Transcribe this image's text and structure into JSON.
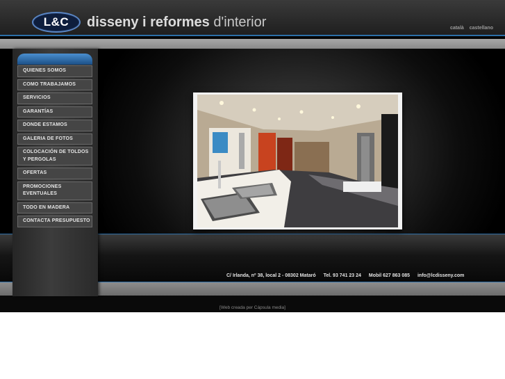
{
  "header": {
    "logo_mark": "L&C",
    "brand_bold": "disseny i reformes",
    "brand_light": "d'interior",
    "languages": [
      "català",
      "castellano"
    ]
  },
  "sidebar": {
    "items": [
      {
        "label": "QUIENES SOMOS"
      },
      {
        "label": "COMO TRABAJAMOS"
      },
      {
        "label": "SERVICIOS"
      },
      {
        "label": "GARANTÍAS"
      },
      {
        "label": "DONDE ESTAMOS"
      },
      {
        "label": "GALERIA DE FOTOS"
      },
      {
        "label": "COLOCACIÓN DE TOLDOS Y PERGOLAS"
      },
      {
        "label": "OFERTAS"
      },
      {
        "label": "PROMOCIONES EVENTUALES"
      },
      {
        "label": "TODO EN MADERA"
      },
      {
        "label": "CONTACTA PRESUPUESTO"
      }
    ]
  },
  "main": {
    "photo_icon": "showroom-kitchen-photo"
  },
  "footer": {
    "address": "C/ Irlanda, nº 38, local 2 - 08302 Mataró",
    "phone": "Tel. 93 741 23 24",
    "mobile": "Mobil 627 863 085",
    "email": "info@lcdisseny.com",
    "credit": "[Web creada per Cápsula media]"
  },
  "colors": {
    "accent_blue": "#2d6fa8",
    "menu_bg": "#454545"
  }
}
